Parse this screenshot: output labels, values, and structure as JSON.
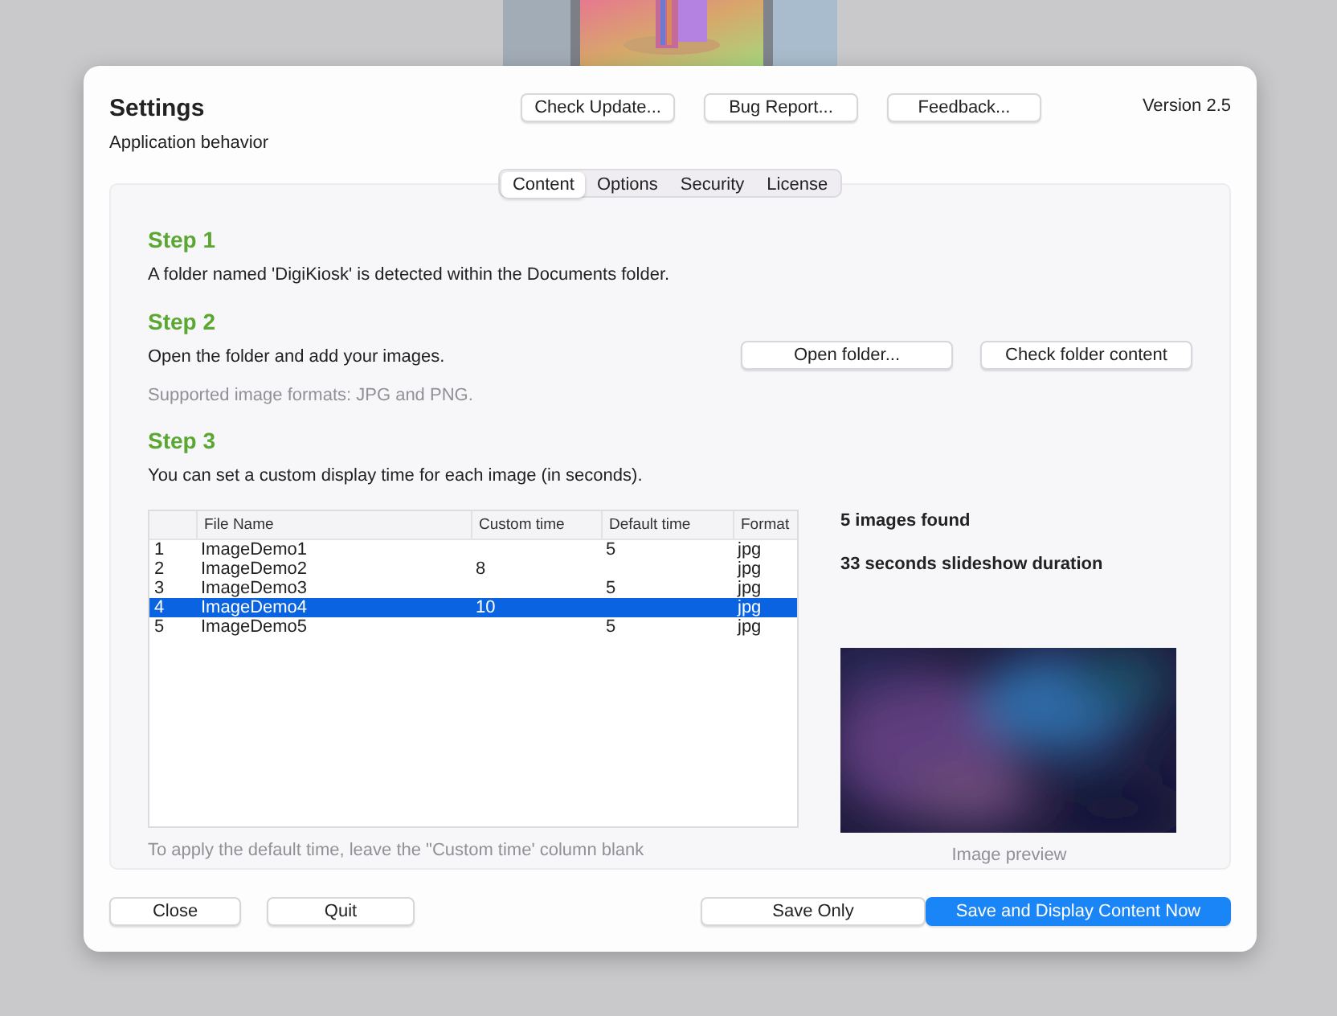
{
  "window": {
    "title": "Settings",
    "subtitle": "Application behavior",
    "version": "Version 2.5"
  },
  "header_buttons": [
    "Check Update...",
    "Bug Report...",
    "Feedback..."
  ],
  "tabs": [
    {
      "label": "Content",
      "selected": true
    },
    {
      "label": "Options",
      "selected": false
    },
    {
      "label": "Security",
      "selected": false
    },
    {
      "label": "License",
      "selected": false
    }
  ],
  "step1": {
    "title": "Step 1",
    "text": "A folder named 'DigiKiosk' is detected within the Documents folder."
  },
  "step2": {
    "title": "Step 2",
    "text": "Open the folder and add your images.",
    "buttons": [
      "Open folder...",
      "Check folder content"
    ],
    "note": "Supported image formats: JPG and PNG."
  },
  "step3": {
    "title": "Step 3",
    "text": "You can set a custom display time for each image (in seconds)."
  },
  "table": {
    "columns": [
      "File Name",
      "Custom time",
      "Default time",
      "Format"
    ],
    "rows": [
      {
        "number": "1",
        "file_name": "ImageDemo1",
        "default_time": "5",
        "format": "jpg",
        "selected": false
      },
      {
        "number": "2",
        "file_name": "ImageDemo2",
        "custom_time": "8",
        "format": "jpg",
        "selected": false
      },
      {
        "number": "3",
        "file_name": "ImageDemo3",
        "default_time": "5",
        "format": "jpg",
        "selected": false
      },
      {
        "number": "4",
        "file_name": "ImageDemo4",
        "custom_time": "10",
        "format": "jpg",
        "selected": true
      },
      {
        "number": "5",
        "file_name": "ImageDemo5",
        "default_time": "5",
        "format": "jpg",
        "selected": false
      }
    ],
    "hint": "To apply the default time, leave the \"Custom time' column blank"
  },
  "summary": [
    "5 images found",
    "33 seconds slideshow duration"
  ],
  "preview": {
    "kind": "picture",
    "caption": "Image preview"
  },
  "footer_buttons": [
    {
      "label": "Close",
      "kind": "secondary"
    },
    {
      "label": "Quit",
      "kind": "secondary"
    },
    {
      "label": "Save Only",
      "kind": "secondary"
    },
    {
      "label": "Save and Display Content Now",
      "kind": "primary"
    }
  ]
}
